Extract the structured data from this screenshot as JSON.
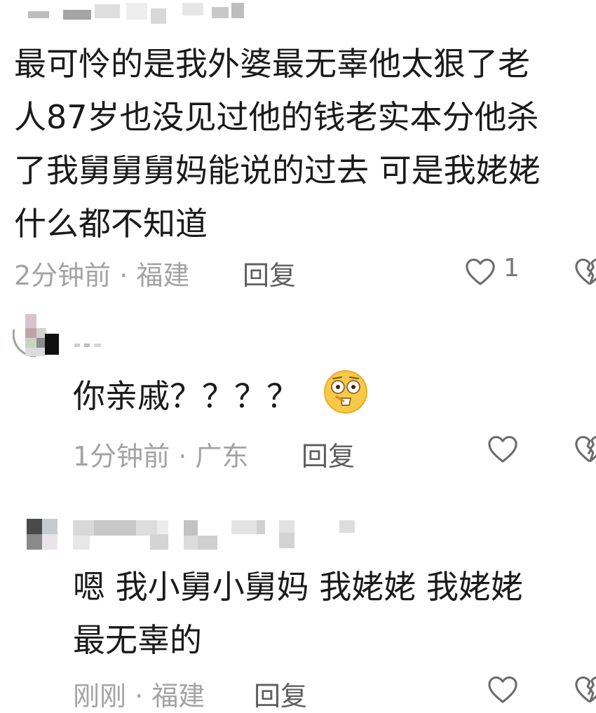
{
  "comments": [
    {
      "username": "",
      "text_lines": [
        "最可怜的是我外婆最无辜他太狠了老",
        "人87岁也没见过他的钱老实本分他杀",
        "了我舅舅舅妈能说的过去 可是我姥姥",
        "什么都不知道"
      ],
      "time": "2分钟前 · 福建",
      "reply_label": "回复",
      "like_count": "1",
      "like_icon": "heart-outline-icon",
      "dislike_icon": "broken-heart-icon"
    },
    {
      "username": "",
      "text_lines": [
        "你亲戚？？？？"
      ],
      "emoji": "flushed-face-icon",
      "time": "1分钟前 · 广东",
      "reply_label": "回复",
      "like_count": "",
      "like_icon": "heart-outline-icon",
      "dislike_icon": "broken-heart-icon"
    },
    {
      "username": "",
      "text_lines": [
        "嗯  我小舅小舅妈  我姥姥  我姥姥",
        "最无辜的"
      ],
      "time": "刚刚 · 福建",
      "reply_label": "回复",
      "like_count": "",
      "like_icon": "heart-outline-icon",
      "dislike_icon": "broken-heart-icon"
    }
  ],
  "colors": {
    "text": "#1a1a1a",
    "meta": "#a3a3a3",
    "reply": "#5e5e5e",
    "icon": "#6b6b6b"
  }
}
